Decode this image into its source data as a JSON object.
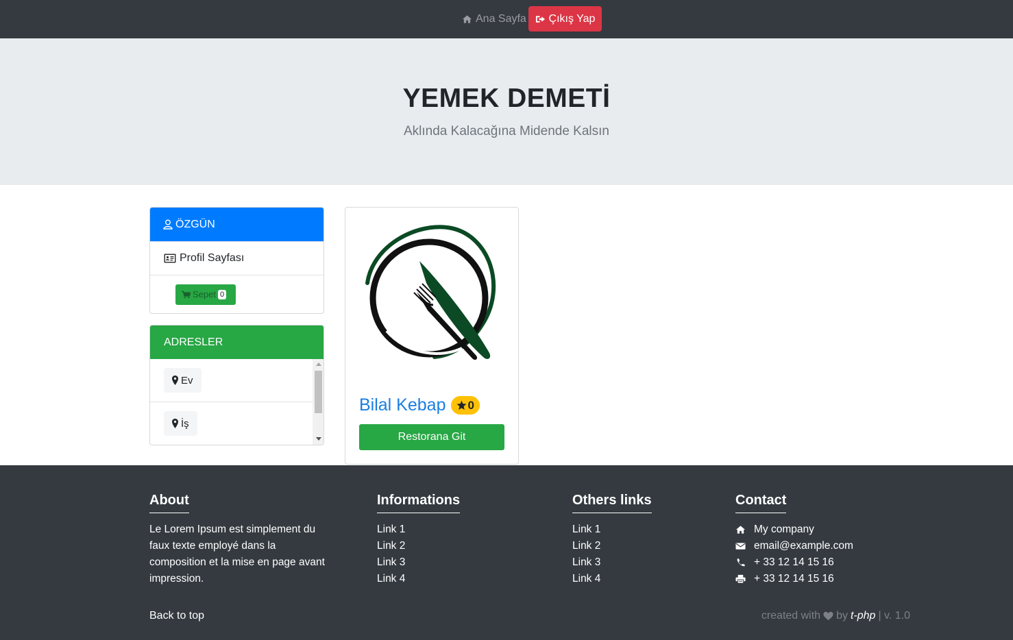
{
  "nav": {
    "home_label": "Ana Sayfa",
    "logout_label": "Çıkış Yap"
  },
  "hero": {
    "title": "YEMEK DEMETİ",
    "subtitle": "Aklında Kalacağına Midende Kalsın"
  },
  "user_card": {
    "username": "ÖZGÜN",
    "profile_label": "Profil Sayfası",
    "cart_label": "Sepet",
    "cart_count": "0"
  },
  "addresses": {
    "header": "ADRESLER",
    "items": [
      {
        "label": "Ev"
      },
      {
        "label": "İş"
      }
    ]
  },
  "restaurant": {
    "name": "Bilal Kebap",
    "rating": "0",
    "button_label": "Restorana Git"
  },
  "footer": {
    "about": {
      "title": "About",
      "text": "Le Lorem Ipsum est simplement du faux texte employé dans la composition et la mise en page avant impression."
    },
    "informations": {
      "title": "Informations",
      "links": [
        "Link 1",
        "Link 2",
        "Link 3",
        "Link 4"
      ]
    },
    "others": {
      "title": "Others links",
      "links": [
        "Link 1",
        "Link 2",
        "Link 3",
        "Link 4"
      ]
    },
    "contact": {
      "title": "Contact",
      "company": "My company",
      "email": "email@example.com",
      "phone": "+ 33 12 14 15 16",
      "fax": "+ 33 12 14 15 16"
    },
    "back_to_top": "Back to top",
    "credits_prefix": "created with",
    "credits_by": "by",
    "credits_brand": "t-php",
    "credits_version": "| v. 1.0"
  },
  "colors": {
    "navbar": "#343a40",
    "primary": "#007bff",
    "success": "#28a745",
    "danger": "#dc3545",
    "warning": "#ffc107",
    "hero_bg": "#e9ecef"
  }
}
